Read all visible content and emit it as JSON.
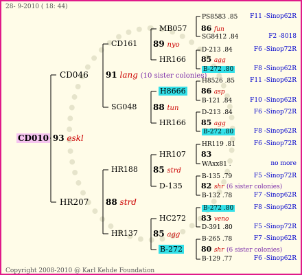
{
  "header": {
    "timestamp": "28- 9-2010 ( 18: 44)"
  },
  "root": {
    "ring": "CD010",
    "year": "93",
    "loft": "eskl"
  },
  "g2": {
    "sire": "CD046",
    "sire_year": "91",
    "sire_loft": "lang",
    "sire_note": "(10 sister colonies)",
    "dam": "HR207",
    "dam_year": "88",
    "dam_loft": "strd"
  },
  "g3": {
    "r1": "CD161",
    "y1": "89",
    "l1": "nyo",
    "r2": "SG048",
    "y2": "88",
    "l2": "tun",
    "r3": "HR188",
    "y3": "85",
    "l3": "strd",
    "r4": "HR137",
    "y4": "85",
    "l4": "agg"
  },
  "g4": {
    "r1": "MB057",
    "y1": "86",
    "l1": "fun",
    "r2": "HR166",
    "y2": "85",
    "l2": "agg",
    "r3": "H8666",
    "y3": "86",
    "l3": "asp",
    "r4": "HR166",
    "y4": "85",
    "l4": "agg",
    "r5": "HR107",
    "y5": "83",
    "r6": "D-135",
    "y6": "82",
    "l6": "shr",
    "n6": "(6 sister colonies)",
    "r7": "HC272",
    "y7": "83",
    "l7": "veno",
    "r8": "B-272",
    "y8": "80",
    "l8": "shr",
    "n8": "(6 sister colonies)"
  },
  "g5": [
    {
      "ring": "PS8583 .85",
      "ref": "F11 -Sinop62R",
      "hl": false
    },
    {
      "ring": "SG8412 .84",
      "ref": "F2 -8018",
      "hl": false
    },
    {
      "ring": "D-213 .84",
      "ref": "F6 -Sinop72R",
      "hl": false
    },
    {
      "ring": "B-272 .80",
      "ref": "F8 -Sinop62R",
      "hl": true
    },
    {
      "ring": "H8526 .85",
      "ref": "F11 -Sinop62R",
      "hl": false
    },
    {
      "ring": "B-121 .84",
      "ref": "F10 -Sinop62R",
      "hl": false
    },
    {
      "ring": "D-213 .84",
      "ref": "F6 -Sinop72R",
      "hl": false
    },
    {
      "ring": "B-272 .80",
      "ref": "F8 -Sinop62R",
      "hl": true
    },
    {
      "ring": "HR119 .81",
      "ref": "F6 -Sinop72R",
      "hl": false
    },
    {
      "ring": "WAxx81 .",
      "ref": "no more",
      "hl": false
    },
    {
      "ring": "B-135 .79",
      "ref": "F5 -Sinop72R",
      "hl": false
    },
    {
      "ring": "B-132 .78",
      "ref": "F7 -Sinop62R",
      "hl": false
    },
    {
      "ring": "B-272 .80",
      "ref": "F8 -Sinop62R",
      "hl": true
    },
    {
      "ring": "D-391 .80",
      "ref": "F5 -Sinop72R",
      "hl": false
    },
    {
      "ring": "B-265 .78",
      "ref": "F7 -Sinop62R",
      "hl": false
    },
    {
      "ring": "B-129 .77",
      "ref": "F6 -Sinop62R",
      "hl": false
    }
  ],
  "footer": {
    "copyright": "Copyright 2008-2010 @ Karl Kehde Foundation"
  }
}
